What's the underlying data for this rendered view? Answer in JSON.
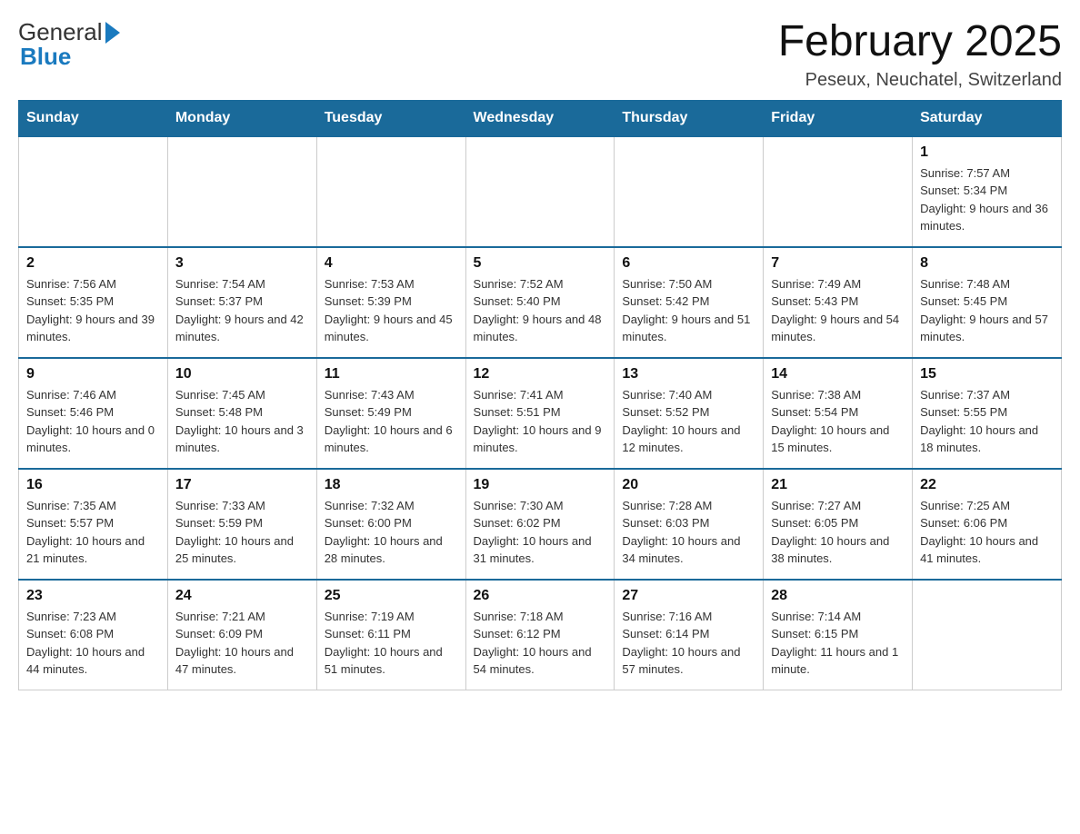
{
  "header": {
    "month_title": "February 2025",
    "location": "Peseux, Neuchatel, Switzerland",
    "logo_line1": "General",
    "logo_line2": "Blue"
  },
  "days_of_week": [
    "Sunday",
    "Monday",
    "Tuesday",
    "Wednesday",
    "Thursday",
    "Friday",
    "Saturday"
  ],
  "weeks": [
    [
      {
        "day": "",
        "info": ""
      },
      {
        "day": "",
        "info": ""
      },
      {
        "day": "",
        "info": ""
      },
      {
        "day": "",
        "info": ""
      },
      {
        "day": "",
        "info": ""
      },
      {
        "day": "",
        "info": ""
      },
      {
        "day": "1",
        "info": "Sunrise: 7:57 AM\nSunset: 5:34 PM\nDaylight: 9 hours and 36 minutes."
      }
    ],
    [
      {
        "day": "2",
        "info": "Sunrise: 7:56 AM\nSunset: 5:35 PM\nDaylight: 9 hours and 39 minutes."
      },
      {
        "day": "3",
        "info": "Sunrise: 7:54 AM\nSunset: 5:37 PM\nDaylight: 9 hours and 42 minutes."
      },
      {
        "day": "4",
        "info": "Sunrise: 7:53 AM\nSunset: 5:39 PM\nDaylight: 9 hours and 45 minutes."
      },
      {
        "day": "5",
        "info": "Sunrise: 7:52 AM\nSunset: 5:40 PM\nDaylight: 9 hours and 48 minutes."
      },
      {
        "day": "6",
        "info": "Sunrise: 7:50 AM\nSunset: 5:42 PM\nDaylight: 9 hours and 51 minutes."
      },
      {
        "day": "7",
        "info": "Sunrise: 7:49 AM\nSunset: 5:43 PM\nDaylight: 9 hours and 54 minutes."
      },
      {
        "day": "8",
        "info": "Sunrise: 7:48 AM\nSunset: 5:45 PM\nDaylight: 9 hours and 57 minutes."
      }
    ],
    [
      {
        "day": "9",
        "info": "Sunrise: 7:46 AM\nSunset: 5:46 PM\nDaylight: 10 hours and 0 minutes."
      },
      {
        "day": "10",
        "info": "Sunrise: 7:45 AM\nSunset: 5:48 PM\nDaylight: 10 hours and 3 minutes."
      },
      {
        "day": "11",
        "info": "Sunrise: 7:43 AM\nSunset: 5:49 PM\nDaylight: 10 hours and 6 minutes."
      },
      {
        "day": "12",
        "info": "Sunrise: 7:41 AM\nSunset: 5:51 PM\nDaylight: 10 hours and 9 minutes."
      },
      {
        "day": "13",
        "info": "Sunrise: 7:40 AM\nSunset: 5:52 PM\nDaylight: 10 hours and 12 minutes."
      },
      {
        "day": "14",
        "info": "Sunrise: 7:38 AM\nSunset: 5:54 PM\nDaylight: 10 hours and 15 minutes."
      },
      {
        "day": "15",
        "info": "Sunrise: 7:37 AM\nSunset: 5:55 PM\nDaylight: 10 hours and 18 minutes."
      }
    ],
    [
      {
        "day": "16",
        "info": "Sunrise: 7:35 AM\nSunset: 5:57 PM\nDaylight: 10 hours and 21 minutes."
      },
      {
        "day": "17",
        "info": "Sunrise: 7:33 AM\nSunset: 5:59 PM\nDaylight: 10 hours and 25 minutes."
      },
      {
        "day": "18",
        "info": "Sunrise: 7:32 AM\nSunset: 6:00 PM\nDaylight: 10 hours and 28 minutes."
      },
      {
        "day": "19",
        "info": "Sunrise: 7:30 AM\nSunset: 6:02 PM\nDaylight: 10 hours and 31 minutes."
      },
      {
        "day": "20",
        "info": "Sunrise: 7:28 AM\nSunset: 6:03 PM\nDaylight: 10 hours and 34 minutes."
      },
      {
        "day": "21",
        "info": "Sunrise: 7:27 AM\nSunset: 6:05 PM\nDaylight: 10 hours and 38 minutes."
      },
      {
        "day": "22",
        "info": "Sunrise: 7:25 AM\nSunset: 6:06 PM\nDaylight: 10 hours and 41 minutes."
      }
    ],
    [
      {
        "day": "23",
        "info": "Sunrise: 7:23 AM\nSunset: 6:08 PM\nDaylight: 10 hours and 44 minutes."
      },
      {
        "day": "24",
        "info": "Sunrise: 7:21 AM\nSunset: 6:09 PM\nDaylight: 10 hours and 47 minutes."
      },
      {
        "day": "25",
        "info": "Sunrise: 7:19 AM\nSunset: 6:11 PM\nDaylight: 10 hours and 51 minutes."
      },
      {
        "day": "26",
        "info": "Sunrise: 7:18 AM\nSunset: 6:12 PM\nDaylight: 10 hours and 54 minutes."
      },
      {
        "day": "27",
        "info": "Sunrise: 7:16 AM\nSunset: 6:14 PM\nDaylight: 10 hours and 57 minutes."
      },
      {
        "day": "28",
        "info": "Sunrise: 7:14 AM\nSunset: 6:15 PM\nDaylight: 11 hours and 1 minute."
      },
      {
        "day": "",
        "info": ""
      }
    ]
  ]
}
